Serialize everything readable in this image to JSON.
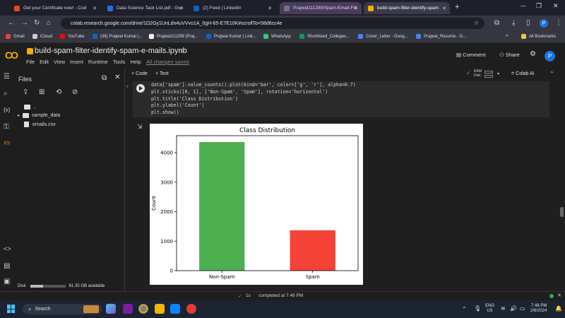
{
  "browser": {
    "tabs": [
      {
        "label": "Get your Certificate now! - Cod",
        "color": "#e64a19"
      },
      {
        "label": "Data Science Task List.pdf - Goo",
        "color": "#1a73e8"
      },
      {
        "label": "(2) Feed | LinkedIn",
        "color": "#0a66c2"
      },
      {
        "label": "Prajwal111299/Spam-Email-Filt",
        "color": "#6e7681"
      },
      {
        "label": "build-spam-filter-identify-spam",
        "color": "#f9ab00"
      }
    ],
    "new_tab": "+",
    "url": "colab.research.google.com/drive/1D2Gy1UnLdn4uVVvo1A_0gH-65-E7E10K#scrollTo=58d6cc4e",
    "profile_initial": "P"
  },
  "bookmarks": [
    {
      "label": "Gmail",
      "color": "#ea4335"
    },
    {
      "label": "iCloud",
      "color": "#cccccc"
    },
    {
      "label": "YouTube",
      "color": "#ff0000"
    },
    {
      "label": "(36) Prajwal Kumar |...",
      "color": "#0a66c2"
    },
    {
      "label": "Prajwal111299 (Praj...",
      "color": "#ffffff"
    },
    {
      "label": "Prajwal Kumar | Link...",
      "color": "#0a66c2"
    },
    {
      "label": "WhatsApp",
      "color": "#25d366"
    },
    {
      "label": "Shortlisted_Colleges...",
      "color": "#0f9d58"
    },
    {
      "label": "Cover_Letter - Goog...",
      "color": "#4285f4"
    },
    {
      "label": "Prajwal_Resume - G...",
      "color": "#4285f4"
    }
  ],
  "bookmarks_more": "»",
  "all_bookmarks": "All Bookmarks",
  "colab": {
    "logo": "CO",
    "notebook_title": "build-spam-filter-identify-spam-e-mails.ipynb",
    "menu": [
      "File",
      "Edit",
      "View",
      "Insert",
      "Runtime",
      "Tools",
      "Help"
    ],
    "saved_status": "All changes saved",
    "comment": "Comment",
    "share": "Share",
    "avatar": "P",
    "add_code": "+ Code",
    "add_text": "+ Text",
    "ram_label": "RAM",
    "disk_label": "Disk",
    "colab_ai": "Colab AI"
  },
  "files_panel": {
    "title": "Files",
    "parent": "..",
    "items": [
      "sample_data",
      "emails.csv"
    ],
    "disk_label": "Disk",
    "disk_text": "81.35 GB available"
  },
  "code_lines": [
    "data['spam'].value_counts().plot(kind='bar', color=['g', 'r'], alpha=0.7)",
    "plt.xticks([0, 1], ['Non-Spam', 'Spam'], rotation='horizontal')",
    "plt.title('Class Distribution')",
    "plt.ylabel('Count')",
    "plt.show()"
  ],
  "chart_data": {
    "type": "bar",
    "title": "Class Distribution",
    "xlabel": "",
    "ylabel": "Count",
    "categories": [
      "Non-Spam",
      "Spam"
    ],
    "values": [
      4360,
      1368
    ],
    "colors": [
      "#4caf50",
      "#f44336"
    ],
    "ylim": [
      0,
      4578
    ],
    "yticks": [
      0,
      1000,
      2000,
      3000,
      4000
    ],
    "grid": false
  },
  "status": {
    "check": "✓",
    "duration": "1s",
    "completed": "completed at 7:46 PM"
  },
  "taskbar": {
    "search": "Search",
    "lang_line1": "ENG",
    "lang_line2": "US",
    "time": "7:48 PM",
    "date": "2/6/2024"
  }
}
